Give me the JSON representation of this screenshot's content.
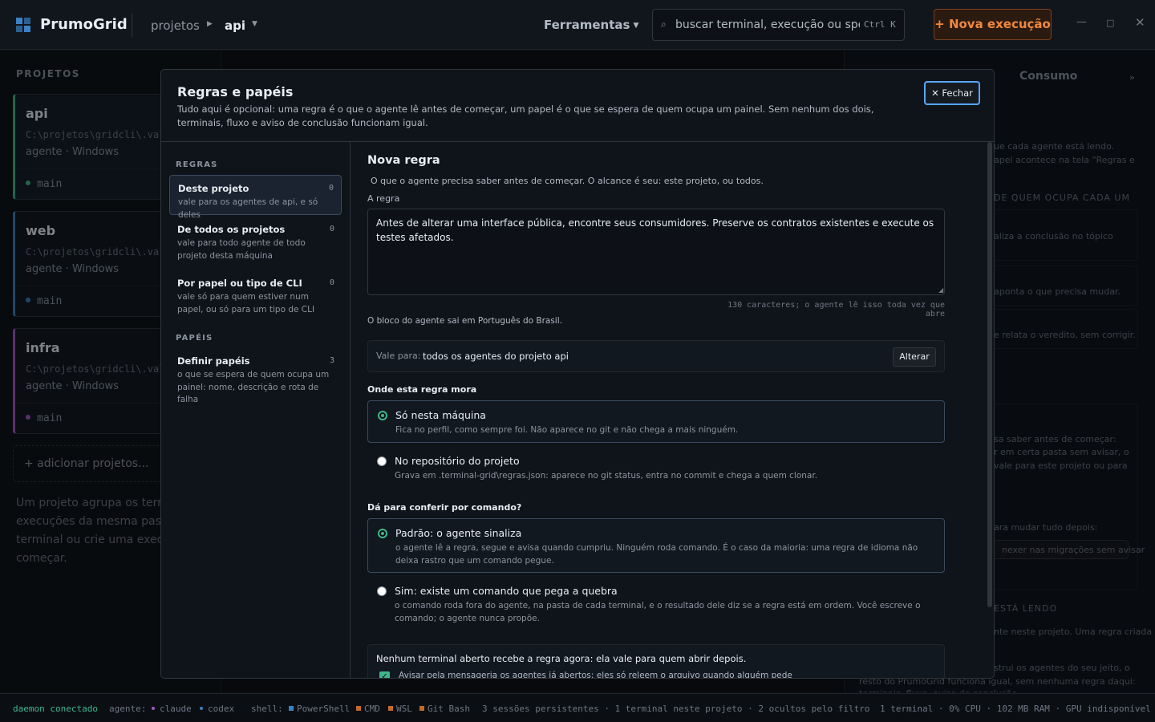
{
  "topbar": {
    "brand": "PrumoGrid",
    "breadcrumb": [
      "projetos",
      "api"
    ],
    "tools_label": "Ferramentas",
    "search_placeholder": "buscar terminal, execução ou spec...",
    "search_shortcut": "Ctrl K",
    "new_run_label": "+ Nova execução",
    "accent": "#f0883e"
  },
  "sidebar": {
    "title": "PROJETOS",
    "projects": [
      {
        "name": "api",
        "path": "C:\\projetos\\gridcli\\.vali",
        "meta": "agente · Windows",
        "branch": "main",
        "color": "#3fb68b"
      },
      {
        "name": "web",
        "path": "C:\\projetos\\gridcli\\.vali",
        "meta": "agente · Windows",
        "branch": "main",
        "color": "#3b82c4"
      },
      {
        "name": "infra",
        "path": "C:\\projetos\\gridcli\\.vali",
        "meta": "agente · Windows",
        "branch": "main",
        "color": "#a259c4"
      }
    ],
    "add_label": "+ adicionar projetos...",
    "help_lines": [
      "Um projeto agrupa os termin",
      "execuções da mesma pasta.",
      "terminal ou crie uma execuçã",
      "começar."
    ]
  },
  "right_panel": {
    "tab": "Consumo",
    "fragments": [
      "ue cada agente está lendo.",
      "apel acontece na tela \"Regras e",
      "DE QUEM OCUPA CADA UM",
      "aliza a conclusão no tópico",
      "aponta o que precisa mudar.",
      "e relata o veredito, sem corrigir.",
      "sa saber antes de começar:",
      "r em certa pasta sem avisar, o",
      "vale para este projeto ou para",
      "ara mudar tudo depois:",
      "nexer nas migrações sem avisar",
      "ESTÁ LENDO",
      "nte neste projeto. Uma regra criada",
      "strui os agentes do seu jeito, o",
      "resto do PrumoGrid funciona igual, sem nenhuma regra daqui:",
      "terminais, fluxo, aviso de conclusão"
    ]
  },
  "modal": {
    "title": "Regras e papéis",
    "description": "Tudo aqui é opcional: uma regra é o que o agente lê antes de começar, um papel é o que se espera de quem ocupa um painel. Sem nenhum dos dois, terminais, fluxo e aviso de conclusão funcionam igual.",
    "close_label": "Fechar",
    "nav": {
      "rules_heading": "REGRAS",
      "roles_heading": "PAPÉIS",
      "items": [
        {
          "label": "Deste projeto",
          "sub": "vale para os agentes de api, e só deles",
          "count": "0"
        },
        {
          "label": "De todos os projetos",
          "sub": "vale para todo agente de todo projeto desta máquina",
          "count": "0"
        },
        {
          "label": "Por papel ou tipo de CLI",
          "sub": "vale só para quem estiver num papel, ou só para um tipo de CLI",
          "count": "0"
        },
        {
          "label": "Definir papéis",
          "sub": "o que se espera de quem ocupa um painel: nome, descrição e rota de falha",
          "count": "3"
        }
      ]
    },
    "form": {
      "title": "Nova regra",
      "subtitle": "O que o agente precisa saber antes de começar. O alcance é seu: este projeto, ou todos.",
      "rule_label": "A regra",
      "rule_text": "Antes de alterar uma interface pública, encontre seus consumidores. Preserve os contratos existentes e execute os testes afetados.",
      "char_count": "130 caracteres; o agente lê isso toda vez que abre",
      "lang_note": "O bloco do agente sai em Português do Brasil.",
      "scope_label": "Vale para:",
      "scope_value": "todos os agentes do projeto api",
      "scope_button": "Alterar",
      "location_heading": "Onde esta regra mora",
      "location_options": [
        {
          "title": "Só nesta máquina",
          "sub": "Fica no perfil, como sempre foi. Não aparece no git e não chega a mais ninguém.",
          "selected": true
        },
        {
          "title": "No repositório do projeto",
          "sub": "Grava em .terminal-grid\\regras.json: aparece no git status, entra no commit e chega a quem clonar.",
          "selected": false
        }
      ],
      "check_heading": "Dá para conferir por comando?",
      "check_options": [
        {
          "title": "Padrão: o agente sinaliza",
          "sub": "o agente lê a regra, segue e avisa quando cumpriu. Ninguém roda comando. É o caso da maioria: uma regra de idioma não deixa rastro que um comando pegue.",
          "selected": true
        },
        {
          "title": "Sim: existe um comando que pega a quebra",
          "sub": "o comando roda fora do agente, na pasta de cada terminal, e o resultado dele diz se a regra está em ordem. Você escreve o comando; o agente nunca propõe.",
          "selected": false
        }
      ],
      "notice_title": "Nenhum terminal aberto recebe a regra agora: ela vale para quem abrir depois.",
      "notice_check": "Avisar pela mensageria os agentes já abertos: eles só releem o arquivo quando alguém pede",
      "notice_checked": true
    }
  },
  "statusbar": {
    "daemon": "daemon conectado",
    "agent_label": "agente:",
    "agents": [
      "claude",
      "codex"
    ],
    "shell_label": "shell:",
    "shells": [
      "PowerShell",
      "CMD",
      "WSL",
      "Git Bash"
    ],
    "sessions": "3 sessões persistentes · 1 terminal neste projeto · 2 ocultos pelo filtro",
    "resources": "1 terminal · 0% CPU · 102 MB RAM · GPU indisponível",
    "colors": {
      "daemon": "#3fb68b",
      "agent": "#a259c4",
      "shell_ps": "#3b82c4",
      "shell_other": "#c4692b"
    }
  }
}
